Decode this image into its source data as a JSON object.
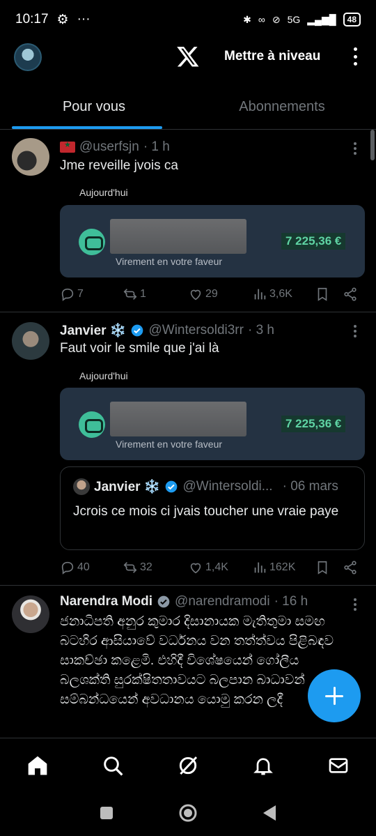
{
  "status_bar": {
    "time": "10:17",
    "network": "5G",
    "battery": "48"
  },
  "header": {
    "upgrade_label": "Mettre à niveau"
  },
  "tabs": [
    {
      "label": "Pour vous",
      "active": true
    },
    {
      "label": "Abonnements",
      "active": false
    }
  ],
  "posts": [
    {
      "name": "",
      "handle": "@userfsjn",
      "time": "· 1 h",
      "text": "Jme reveille jvois ca",
      "media": {
        "today": "Aujourd'hui",
        "subtitle": "Virement en votre faveur",
        "amount": "7 225,36 €"
      },
      "stats": {
        "replies": "7",
        "reposts": "1",
        "likes": "29",
        "views": "3,6K"
      }
    },
    {
      "name": "Janvier ❄️",
      "handle": "@Wintersoldi3rr",
      "time": "· 3 h",
      "text": "Faut voir le smile que j'ai là",
      "media": {
        "today": "Aujourd'hui",
        "subtitle": "Virement en votre faveur",
        "amount": "7 225,36 €"
      },
      "quote": {
        "name": "Janvier ❄️",
        "handle": "@Wintersoldi...",
        "time": "· 06 mars",
        "text": "Jcrois ce mois ci jvais toucher une vraie paye"
      },
      "stats": {
        "replies": "40",
        "reposts": "32",
        "likes": "1,4K",
        "views": "162K"
      }
    },
    {
      "name": "Narendra Modi",
      "handle": "@narendramodi",
      "time": "· 16 h",
      "text": "ජනාධිපති අනුර කුමාර දිසානායක මැතිතුමා සමඟ බටහිර ආසියාවේ වර්ධනය වන තත්ත්වය පිළිබඳව සාකච්ඡා කළෙමි. එහිදී විශේෂයෙන් ගෝලීය බලශක්ති සුරක්ෂිතතාවයට බලපාන බාධාවන් සම්බන්ධයෙන් අවධානය යොමු කරන ලදී"
    }
  ],
  "colors": {
    "accent": "#1d9bf0",
    "background": "#000000",
    "text": "#e7e9ea",
    "muted": "#71767b",
    "card": "#243242",
    "amount": "#5fd4a4"
  }
}
